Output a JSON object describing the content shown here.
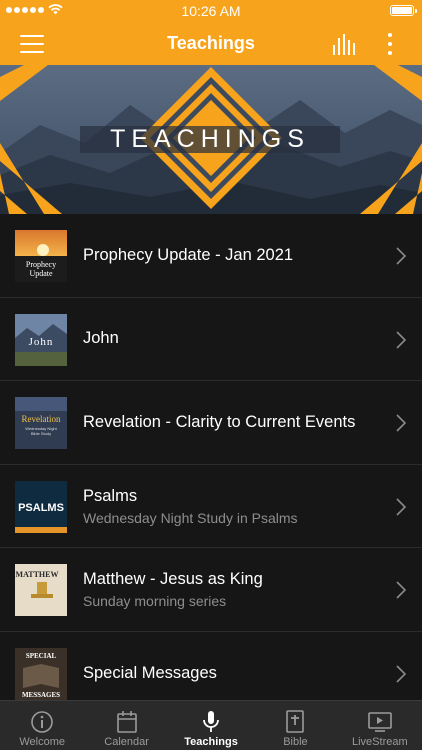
{
  "status_bar": {
    "time": "10:26 AM"
  },
  "nav": {
    "title": "Teachings"
  },
  "banner": {
    "title": "TEACHINGS"
  },
  "colors": {
    "accent": "#f8a31c",
    "background": "#161616",
    "tab_bar": "#2a2a2a",
    "subtitle": "#8e8e8e"
  },
  "teachings": [
    {
      "title": "Prophecy Update - Jan 2021",
      "subtitle": "",
      "thumb_text": [
        "Prophecy",
        "Update"
      ]
    },
    {
      "title": "John",
      "subtitle": "",
      "thumb_text": [
        "John"
      ]
    },
    {
      "title": "Revelation - Clarity to Current Events",
      "subtitle": "",
      "thumb_text": [
        "Revelation",
        "Wednesday Night",
        "Bible Study"
      ]
    },
    {
      "title": "Psalms",
      "subtitle": "Wednesday Night Study in Psalms",
      "thumb_text": [
        "PSALMS"
      ]
    },
    {
      "title": "Matthew - Jesus as King",
      "subtitle": "Sunday morning series",
      "thumb_text": [
        "MATTHEW"
      ]
    },
    {
      "title": "Special Messages",
      "subtitle": "",
      "thumb_text": [
        "SPECIAL",
        "MESSAGES"
      ]
    }
  ],
  "tabs": [
    {
      "label": "Welcome",
      "icon": "info-icon",
      "active": false
    },
    {
      "label": "Calendar",
      "icon": "calendar-icon",
      "active": false
    },
    {
      "label": "Teachings",
      "icon": "microphone-icon",
      "active": true
    },
    {
      "label": "Bible",
      "icon": "bible-icon",
      "active": false
    },
    {
      "label": "LiveStream",
      "icon": "tv-play-icon",
      "active": false
    }
  ]
}
